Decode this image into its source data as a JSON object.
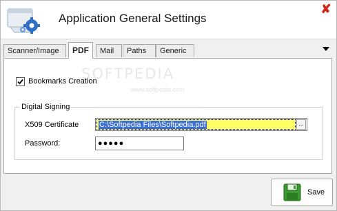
{
  "window": {
    "title": "Application General Settings",
    "close_symbol": "✘",
    "accent_color": "#d02a1a"
  },
  "tabs": [
    {
      "label": "Scanner/Image",
      "active": false
    },
    {
      "label": "PDF",
      "active": true
    },
    {
      "label": "Mail",
      "active": false
    },
    {
      "label": "Paths",
      "active": false
    },
    {
      "label": "Generic",
      "active": false
    }
  ],
  "pdf": {
    "bookmarks": {
      "label": "Bookmarks Creation",
      "checked": true
    },
    "digital_signing": {
      "legend": "Digital Signing",
      "certificate_label": "X509 Certificate",
      "certificate_value": "C:\\Softpedia Files\\Softpedia.pdf",
      "browse_label": "...",
      "password_label": "Password:",
      "password_value": "●●●●●"
    }
  },
  "watermark": {
    "text": "SOFTPEDIA",
    "sub": "www.softpedia.com"
  },
  "footer": {
    "save_label": "Save"
  },
  "icons": [
    "app-settings-icon",
    "close-icon",
    "tab-menu-icon",
    "check-icon",
    "save-icon"
  ]
}
